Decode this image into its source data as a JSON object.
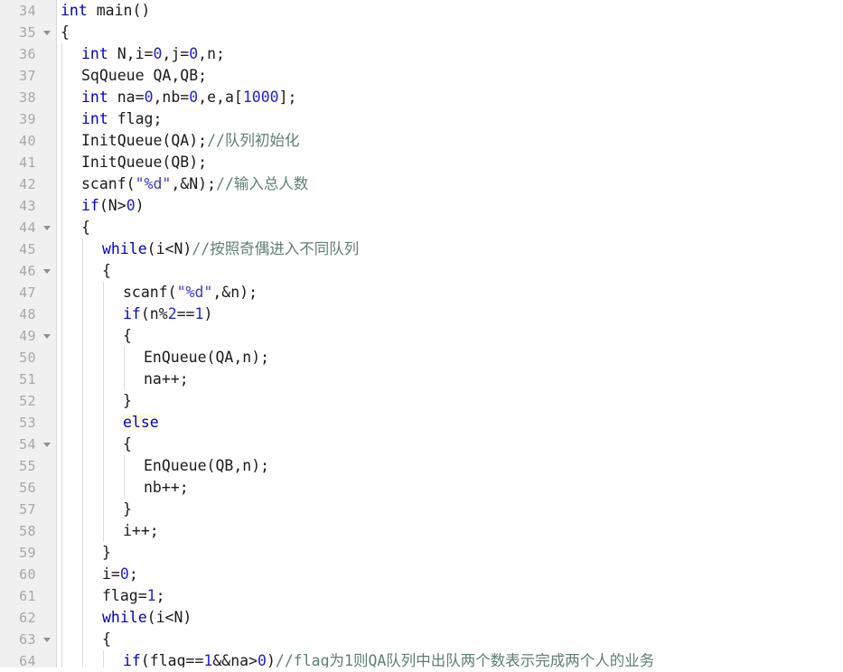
{
  "editor": {
    "title": "code-editor",
    "language": "C",
    "first_line_number": 34,
    "last_line_number": 64,
    "line_height_px": 24,
    "colors": {
      "background": "#ffffff",
      "gutter_background": "#f0f0f0",
      "gutter_text": "#a8a8a8",
      "gutter_border": "#d8d8d8",
      "keyword": "#0000c8",
      "number": "#2222cc",
      "string": "#3a3ad0",
      "comment": "#5f7f72",
      "text": "#1a1a1a",
      "indent_guide": "#dcdcdc",
      "highlight": "#fdfbe3"
    }
  },
  "lines": [
    {
      "number": "34",
      "fold": false,
      "indent": 0,
      "tokens": [
        {
          "t": "int",
          "c": "kw"
        },
        {
          "t": " main()",
          "c": "plain"
        }
      ]
    },
    {
      "number": "35",
      "fold": true,
      "indent": 0,
      "tokens": [
        {
          "t": "{",
          "c": "plain"
        }
      ]
    },
    {
      "number": "36",
      "fold": false,
      "indent": 1,
      "tokens": [
        {
          "t": "int",
          "c": "kw"
        },
        {
          "t": " N,i=",
          "c": "plain"
        },
        {
          "t": "0",
          "c": "num"
        },
        {
          "t": ",j=",
          "c": "plain"
        },
        {
          "t": "0",
          "c": "num"
        },
        {
          "t": ",n;",
          "c": "plain"
        }
      ]
    },
    {
      "number": "37",
      "fold": false,
      "indent": 1,
      "tokens": [
        {
          "t": "SqQueue QA,QB;",
          "c": "plain"
        }
      ]
    },
    {
      "number": "38",
      "fold": false,
      "indent": 1,
      "tokens": [
        {
          "t": "int",
          "c": "kw"
        },
        {
          "t": " na=",
          "c": "plain"
        },
        {
          "t": "0",
          "c": "num"
        },
        {
          "t": ",nb=",
          "c": "plain"
        },
        {
          "t": "0",
          "c": "num"
        },
        {
          "t": ",e,a[",
          "c": "plain"
        },
        {
          "t": "1000",
          "c": "num"
        },
        {
          "t": "];",
          "c": "plain"
        }
      ]
    },
    {
      "number": "39",
      "fold": false,
      "indent": 1,
      "tokens": [
        {
          "t": "int",
          "c": "kw"
        },
        {
          "t": " flag;",
          "c": "plain"
        }
      ]
    },
    {
      "number": "40",
      "fold": false,
      "indent": 1,
      "tokens": [
        {
          "t": "InitQueue(QA);",
          "c": "plain"
        },
        {
          "t": "//队列初始化",
          "c": "cmt"
        }
      ]
    },
    {
      "number": "41",
      "fold": false,
      "indent": 1,
      "tokens": [
        {
          "t": "InitQueue(QB);",
          "c": "plain"
        }
      ]
    },
    {
      "number": "42",
      "fold": false,
      "indent": 1,
      "tokens": [
        {
          "t": "scanf(",
          "c": "plain"
        },
        {
          "t": "\"%d\"",
          "c": "str"
        },
        {
          "t": ",&N);",
          "c": "plain"
        },
        {
          "t": "//输入总人数",
          "c": "cmt"
        }
      ]
    },
    {
      "number": "43",
      "fold": false,
      "indent": 1,
      "tokens": [
        {
          "t": "if",
          "c": "kw"
        },
        {
          "t": "(N>",
          "c": "plain"
        },
        {
          "t": "0",
          "c": "num"
        },
        {
          "t": ")",
          "c": "plain"
        }
      ]
    },
    {
      "number": "44",
      "fold": true,
      "indent": 1,
      "tokens": [
        {
          "t": "{",
          "c": "plain"
        }
      ]
    },
    {
      "number": "45",
      "fold": false,
      "indent": 2,
      "tokens": [
        {
          "t": "while",
          "c": "kw"
        },
        {
          "t": "(i<N)",
          "c": "plain"
        },
        {
          "t": "//按照奇偶进入不同队列",
          "c": "cmt"
        }
      ]
    },
    {
      "number": "46",
      "fold": true,
      "indent": 2,
      "tokens": [
        {
          "t": "{",
          "c": "plain"
        }
      ]
    },
    {
      "number": "47",
      "fold": false,
      "indent": 3,
      "tokens": [
        {
          "t": "scanf(",
          "c": "plain"
        },
        {
          "t": "\"%d\"",
          "c": "str"
        },
        {
          "t": ",&n);",
          "c": "plain"
        }
      ]
    },
    {
      "number": "48",
      "fold": false,
      "indent": 3,
      "tokens": [
        {
          "t": "if",
          "c": "kw"
        },
        {
          "t": "(n%",
          "c": "plain"
        },
        {
          "t": "2",
          "c": "num"
        },
        {
          "t": "==",
          "c": "plain"
        },
        {
          "t": "1",
          "c": "num"
        },
        {
          "t": ")",
          "c": "plain"
        }
      ]
    },
    {
      "number": "49",
      "fold": true,
      "indent": 3,
      "tokens": [
        {
          "t": "{",
          "c": "plain"
        }
      ]
    },
    {
      "number": "50",
      "fold": false,
      "indent": 4,
      "tokens": [
        {
          "t": "EnQueue(QA,n);",
          "c": "plain"
        }
      ]
    },
    {
      "number": "51",
      "fold": false,
      "indent": 4,
      "tokens": [
        {
          "t": "na++;",
          "c": "plain"
        }
      ]
    },
    {
      "number": "52",
      "fold": false,
      "indent": 3,
      "tokens": [
        {
          "t": "}",
          "c": "plain"
        }
      ]
    },
    {
      "number": "53",
      "fold": false,
      "indent": 3,
      "tokens": [
        {
          "t": "else",
          "c": "kw hl"
        }
      ]
    },
    {
      "number": "54",
      "fold": true,
      "indent": 3,
      "tokens": [
        {
          "t": "{",
          "c": "plain"
        }
      ]
    },
    {
      "number": "55",
      "fold": false,
      "indent": 4,
      "tokens": [
        {
          "t": "EnQueue(QB,n);",
          "c": "plain"
        }
      ]
    },
    {
      "number": "56",
      "fold": false,
      "indent": 4,
      "tokens": [
        {
          "t": "nb++;",
          "c": "plain"
        }
      ]
    },
    {
      "number": "57",
      "fold": false,
      "indent": 3,
      "tokens": [
        {
          "t": "}",
          "c": "plain"
        }
      ]
    },
    {
      "number": "58",
      "fold": false,
      "indent": 3,
      "tokens": [
        {
          "t": "i++;",
          "c": "plain"
        }
      ]
    },
    {
      "number": "59",
      "fold": false,
      "indent": 2,
      "tokens": [
        {
          "t": "}",
          "c": "plain"
        }
      ]
    },
    {
      "number": "60",
      "fold": false,
      "indent": 2,
      "tokens": [
        {
          "t": "i=",
          "c": "plain"
        },
        {
          "t": "0",
          "c": "num"
        },
        {
          "t": ";",
          "c": "plain"
        }
      ]
    },
    {
      "number": "61",
      "fold": false,
      "indent": 2,
      "tokens": [
        {
          "t": "flag=",
          "c": "plain"
        },
        {
          "t": "1",
          "c": "num"
        },
        {
          "t": ";",
          "c": "plain"
        }
      ]
    },
    {
      "number": "62",
      "fold": false,
      "indent": 2,
      "tokens": [
        {
          "t": "while",
          "c": "kw"
        },
        {
          "t": "(i<N)",
          "c": "plain"
        }
      ]
    },
    {
      "number": "63",
      "fold": true,
      "indent": 2,
      "tokens": [
        {
          "t": "{",
          "c": "plain"
        }
      ]
    },
    {
      "number": "64",
      "fold": false,
      "indent": 3,
      "tokens": [
        {
          "t": "if",
          "c": "kw"
        },
        {
          "t": "(flag==",
          "c": "plain"
        },
        {
          "t": "1",
          "c": "num"
        },
        {
          "t": "&&na>",
          "c": "plain"
        },
        {
          "t": "0",
          "c": "num"
        },
        {
          "t": ")",
          "c": "plain"
        },
        {
          "t": "//flag为1则QA队列中出队两个数表示完成两个人的业务",
          "c": "cmt"
        }
      ]
    }
  ]
}
